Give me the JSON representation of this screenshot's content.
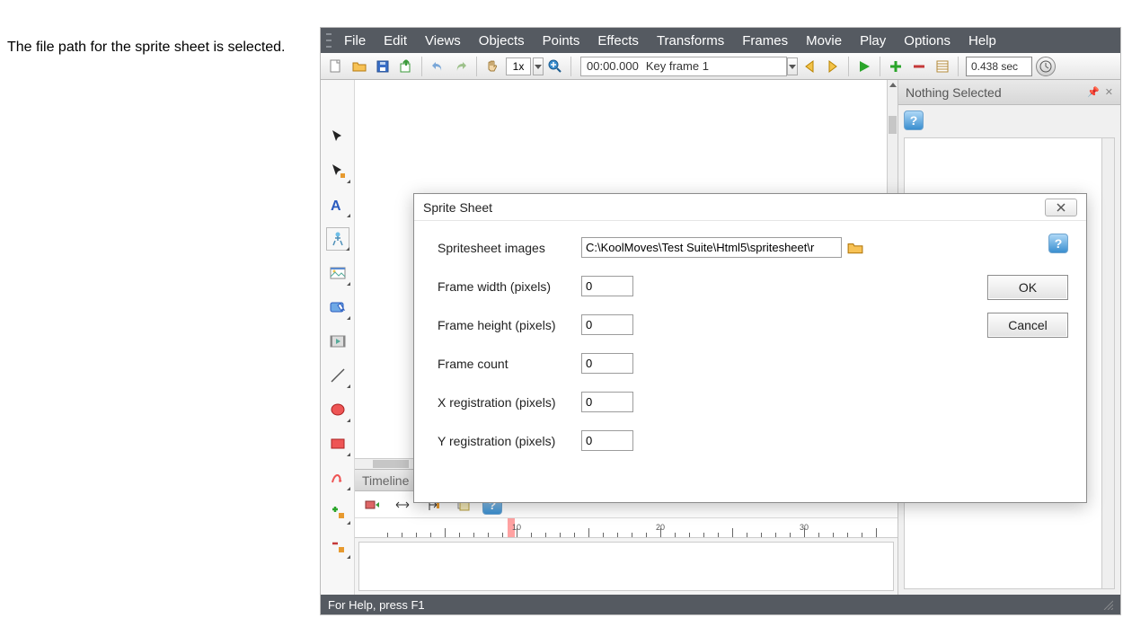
{
  "annotation": "The file path for the sprite sheet is selected.",
  "menu": {
    "file": "File",
    "edit": "Edit",
    "views": "Views",
    "objects": "Objects",
    "points": "Points",
    "effects": "Effects",
    "transforms": "Transforms",
    "frames": "Frames",
    "movie": "Movie",
    "play": "Play",
    "options": "Options",
    "help": "Help"
  },
  "toolbar": {
    "zoom": "1x",
    "frame_time": "00:00.000",
    "frame_name": "Key frame 1",
    "seconds": "0.438 sec"
  },
  "panel": {
    "title": "Nothing Selected"
  },
  "timeline": {
    "title": "Timeline",
    "ticks": [
      10,
      20,
      30
    ]
  },
  "status": "For Help, press F1",
  "dialog": {
    "title": "Sprite Sheet",
    "labels": {
      "images": "Spritesheet images",
      "fw": "Frame width (pixels)",
      "fh": "Frame height (pixels)",
      "fc": "Frame count",
      "xr": "X registration (pixels)",
      "yr": "Y registration (pixels)"
    },
    "values": {
      "path": "C:\\KoolMoves\\Test Suite\\Html5\\spritesheet\\r",
      "fw": "0",
      "fh": "0",
      "fc": "0",
      "xr": "0",
      "yr": "0"
    },
    "buttons": {
      "ok": "OK",
      "cancel": "Cancel"
    }
  }
}
